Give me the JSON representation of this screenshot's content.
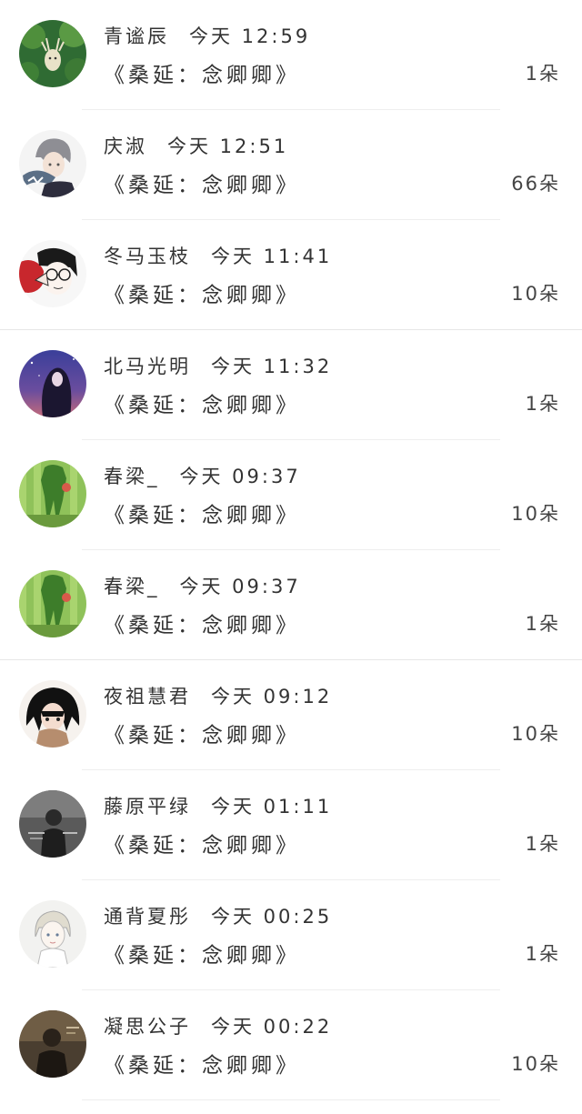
{
  "rows": [
    {
      "name": "青谧辰",
      "time": "今天 12:59",
      "message": "《桑延：念卿卿》",
      "count": "1朵",
      "avatar_icon": "deer-avatar-icon"
    },
    {
      "name": "庆淑",
      "time": "今天 12:51",
      "message": "《桑延：念卿卿》",
      "count": "66朵",
      "avatar_icon": "anime-boy-shark-avatar-icon"
    },
    {
      "name": "冬马玉枝",
      "time": "今天 11:41",
      "message": "《桑延：念卿卿》",
      "count": "10朵",
      "avatar_icon": "anime-glasses-avatar-icon"
    },
    {
      "name": "北马光明",
      "time": "今天 11:32",
      "message": "《桑延：念卿卿》",
      "count": "1朵",
      "avatar_icon": "night-girl-avatar-icon"
    },
    {
      "name": "春梁_",
      "time": "今天 09:37",
      "message": "《桑延：念卿卿》",
      "count": "10朵",
      "avatar_icon": "green-figure-avatar-icon"
    },
    {
      "name": "春梁_",
      "time": "今天 09:37",
      "message": "《桑延：念卿卿》",
      "count": "1朵",
      "avatar_icon": "green-figure-avatar-icon"
    },
    {
      "name": "夜祖慧君",
      "time": "今天 09:12",
      "message": "《桑延：念卿卿》",
      "count": "10朵",
      "avatar_icon": "anime-dark-hair-avatar-icon"
    },
    {
      "name": "藤原平绿",
      "time": "今天 01:11",
      "message": "《桑延：念卿卿》",
      "count": "1朵",
      "avatar_icon": "grayscale-person-avatar-icon"
    },
    {
      "name": "通背夏彤",
      "time": "今天 00:25",
      "message": "《桑延：念卿卿》",
      "count": "1朵",
      "avatar_icon": "sketch-girl-avatar-icon"
    },
    {
      "name": "凝思公子",
      "time": "今天 00:22",
      "message": "《桑延：念卿卿》",
      "count": "10朵",
      "avatar_icon": "sepia-person-avatar-icon"
    }
  ],
  "colors": {
    "text": "#333333",
    "divider": "#e7e7e7",
    "background": "#ffffff"
  }
}
